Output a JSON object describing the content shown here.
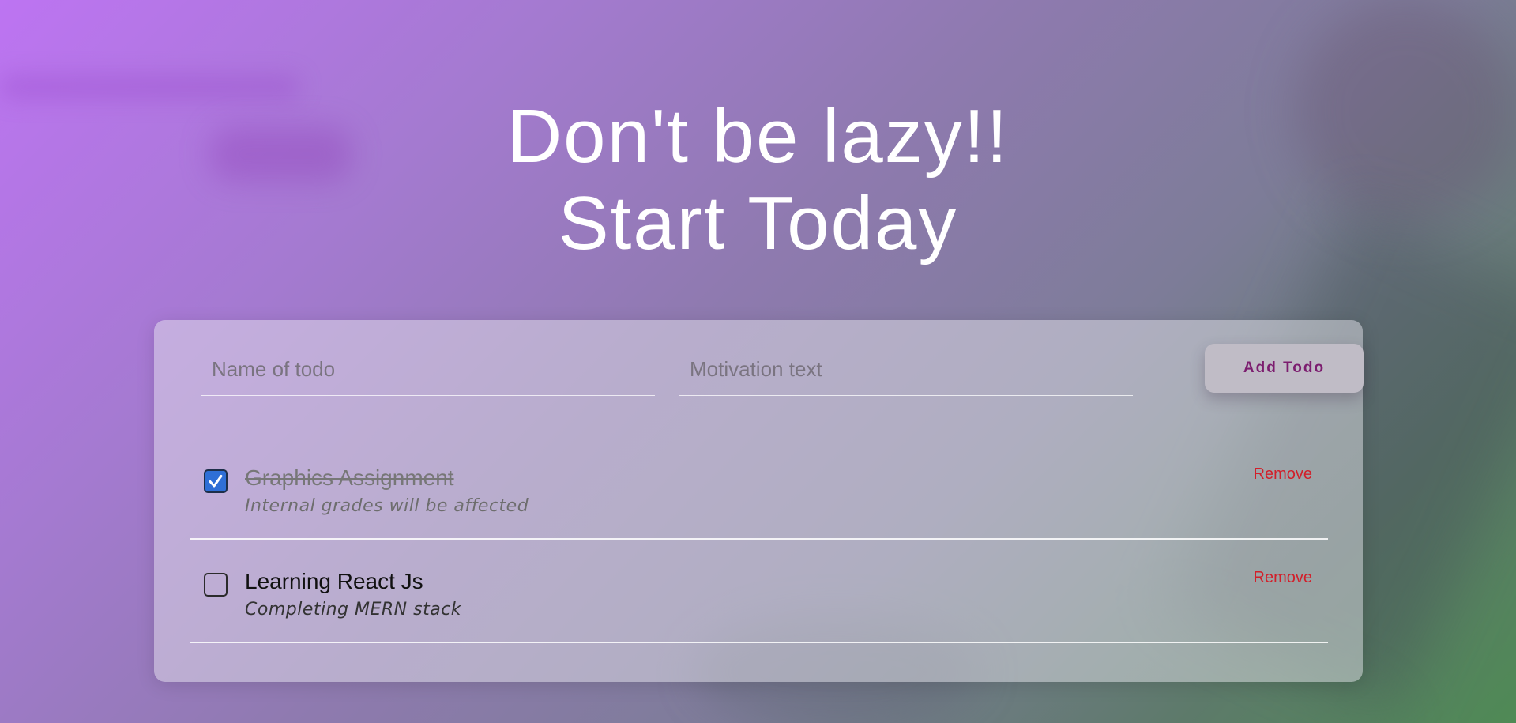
{
  "heading": {
    "line1": "Don't be lazy!!",
    "line2": "Start Today"
  },
  "form": {
    "name_placeholder": "Name of todo",
    "motivation_placeholder": "Motivation text",
    "add_button_label": "Add Todo"
  },
  "todos": [
    {
      "title": "Graphics Assignment",
      "motivation": "Internal grades will be affected",
      "completed": true,
      "remove_label": "Remove"
    },
    {
      "title": "Learning React Js",
      "motivation": "Completing MERN stack",
      "completed": false,
      "remove_label": "Remove"
    }
  ],
  "colors": {
    "accent_button_text": "#7c1d6f",
    "remove_text": "#d21f2a",
    "checkbox_checked": "#2f6fd6"
  },
  "icons": {
    "check": "checkmark-icon"
  }
}
